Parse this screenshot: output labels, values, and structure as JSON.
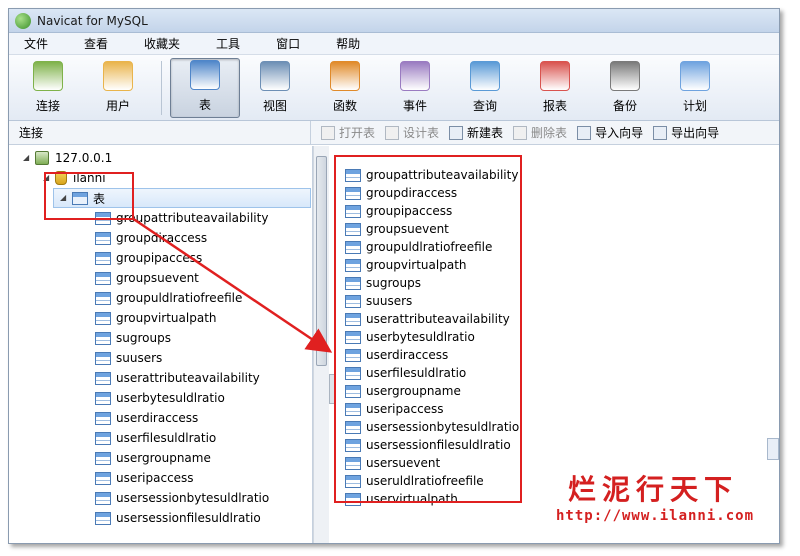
{
  "window": {
    "title": "Navicat for MySQL"
  },
  "menu": [
    "文件",
    "查看",
    "收藏夹",
    "工具",
    "窗口",
    "帮助"
  ],
  "toolbar": [
    {
      "label": "连接",
      "icon": "connection-icon",
      "active": false
    },
    {
      "label": "用户",
      "icon": "user-icon",
      "active": false
    },
    {
      "label": "表",
      "icon": "table-icon",
      "active": true
    },
    {
      "label": "视图",
      "icon": "view-icon",
      "active": false
    },
    {
      "label": "函数",
      "icon": "function-icon",
      "active": false
    },
    {
      "label": "事件",
      "icon": "event-icon",
      "active": false
    },
    {
      "label": "查询",
      "icon": "query-icon",
      "active": false
    },
    {
      "label": "报表",
      "icon": "report-icon",
      "active": false
    },
    {
      "label": "备份",
      "icon": "backup-icon",
      "active": false
    },
    {
      "label": "计划",
      "icon": "schedule-icon",
      "active": false
    }
  ],
  "subbar": {
    "connection_label": "连接",
    "buttons": [
      {
        "label": "打开表",
        "enabled": false
      },
      {
        "label": "设计表",
        "enabled": false
      },
      {
        "label": "新建表",
        "enabled": true
      },
      {
        "label": "删除表",
        "enabled": false
      },
      {
        "label": "导入向导",
        "enabled": true
      },
      {
        "label": "导出向导",
        "enabled": true
      }
    ]
  },
  "tree": {
    "server": "127.0.0.1",
    "database": "ilanni",
    "tables_folder": "表",
    "tables": [
      "groupattributeavailability",
      "groupdiraccess",
      "groupipaccess",
      "groupsuevent",
      "groupuldlratiofreefile",
      "groupvirtualpath",
      "sugroups",
      "suusers",
      "userattributeavailability",
      "userbytesuldlratio",
      "userdiraccess",
      "userfilesuldlratio",
      "usergroupname",
      "useripaccess",
      "usersessionbytesuldlratio",
      "usersessionfilesuldlratio"
    ]
  },
  "object_list": [
    "groupattributeavailability",
    "groupdiraccess",
    "groupipaccess",
    "groupsuevent",
    "groupuldlratiofreefile",
    "groupvirtualpath",
    "sugroups",
    "suusers",
    "userattributeavailability",
    "userbytesuldlratio",
    "userdiraccess",
    "userfilesuldlratio",
    "usergroupname",
    "useripaccess",
    "usersessionbytesuldlratio",
    "usersessionfilesuldlratio",
    "usersuevent",
    "useruldlratiofreefile",
    "uservirtualpath"
  ],
  "watermark": {
    "title": "烂泥行天下",
    "url": "http://www.ilanni.com"
  },
  "colors": {
    "annotation": "#e02020",
    "selection": "#d8e8fa"
  }
}
